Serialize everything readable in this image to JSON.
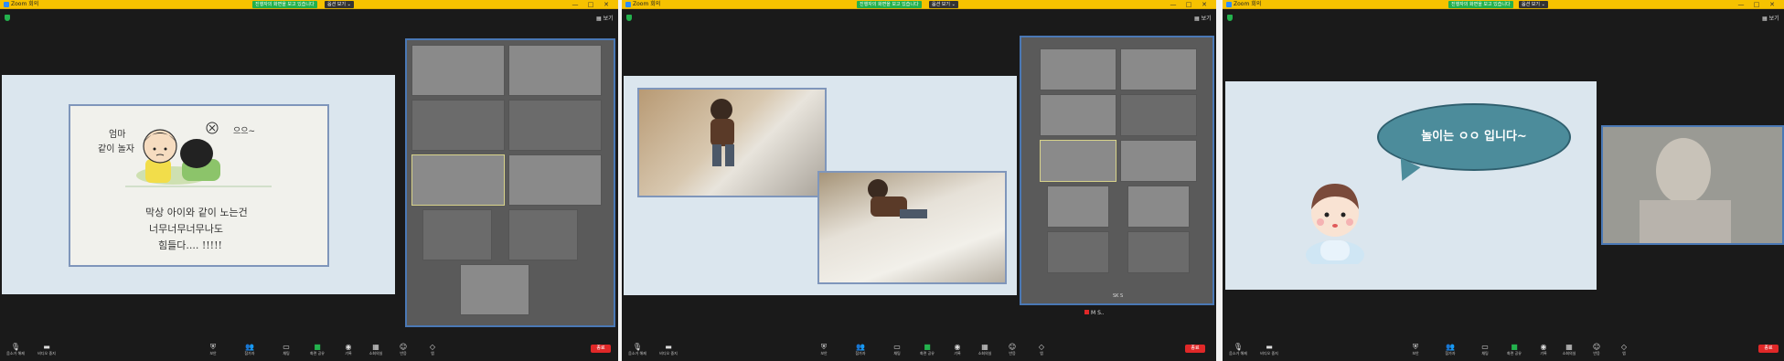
{
  "window": {
    "title": "Zoom 회의",
    "banner": "진행자의 화면을 보고 있습니다",
    "view_options": "옵션 보기 ⌄",
    "view_label": "보기",
    "minimize": "—",
    "maximize": "□",
    "close": "✕"
  },
  "toolbar": {
    "mute": "음소거 해제",
    "video": "비디오 중지",
    "security": "보안",
    "participants": "참가자",
    "chat": "채팅",
    "share": "화면 공유",
    "record": "기록",
    "breakout": "소회의실",
    "reactions": "반응",
    "apps": "앱",
    "end": "종료"
  },
  "slide1": {
    "word1": "엄마",
    "word2": "같이 놀자",
    "word3": "으으~",
    "line1": "막상 아이와 같이 노는건",
    "line2": "너무너무너무나도",
    "line3": "힘들다.... !!!!!"
  },
  "slide3": {
    "bubble_text": "놀이는 ㅇㅇ 입니다~"
  },
  "panel2": {
    "name_tag": "M S..",
    "grid_label": "SK S"
  },
  "icons": {
    "mute": "mic-off-icon",
    "video": "video-icon",
    "security": "shield-icon",
    "participants": "people-icon",
    "chat": "chat-icon",
    "share": "share-screen-icon",
    "record": "record-icon",
    "breakout": "grid-icon",
    "reactions": "smile-icon",
    "apps": "apps-icon"
  },
  "colors": {
    "titlebar": "#f6c200",
    "banner": "#23b14d",
    "end": "#e02828",
    "slide_bg": "#dbe6ee",
    "frame_border": "#4a78b5"
  }
}
